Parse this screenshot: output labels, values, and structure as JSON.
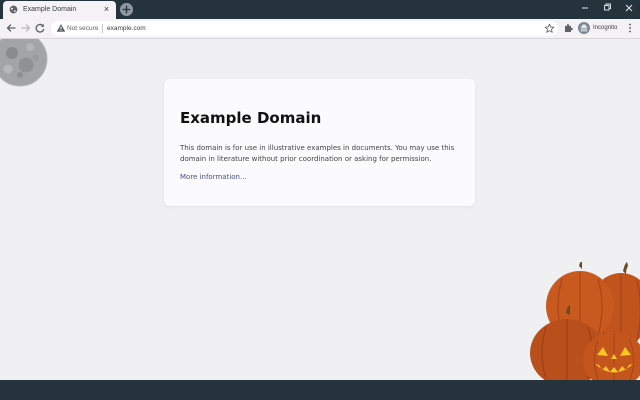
{
  "tab": {
    "title": "Example Domain",
    "close_glyph": "×",
    "favicon": "globe-icon"
  },
  "newtab": {
    "icon": "plus-icon"
  },
  "window_controls": {
    "icons": [
      "minimize-icon",
      "restore-icon",
      "close-icon"
    ]
  },
  "toolbar": {
    "back_icon": "arrow-left-icon",
    "forward_icon": "arrow-right-icon",
    "reload_icon": "reload-icon",
    "security_label": "Not secure",
    "url": "example.com",
    "bookmark_icon": "star-icon",
    "extensions_icon": "puzzle-icon",
    "incognito_label": "Incognito",
    "menu_icon": "kebab-menu-icon"
  },
  "page": {
    "heading": "Example Domain",
    "paragraph": "This domain is for use in illustrative examples in documents. You may use this domain in literature without prior coordination or asking for permission.",
    "link_text": "More information..."
  },
  "theme": {
    "frame_color": "#25333d",
    "toolbar_color": "#f4f2f5",
    "page_background": "#f0eff2",
    "link_color": "#4a4f8c",
    "decorations": [
      "moon",
      "pumpkins"
    ]
  }
}
